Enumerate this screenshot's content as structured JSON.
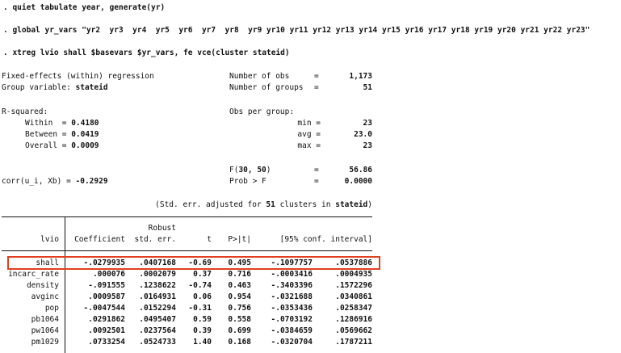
{
  "commands": [
    ". quiet tabulate year, generate(yr)",
    ". global yr_vars \"yr2  yr3  yr4  yr5  yr6  yr7  yr8  yr9 yr10 yr11 yr12 yr13 yr14 yr15 yr16 yr17 yr18 yr19 yr20 yr21 yr22 yr23\"",
    ". xtreg lvio shall $basevars $yr_vars, fe vce(cluster stateid)"
  ],
  "header": {
    "model": "Fixed-effects (within) regression",
    "group_label": "Group variable: ",
    "group_value": "stateid",
    "nobs_label": "Number of obs",
    "nobs_eq": "=",
    "nobs_value": "1,173",
    "ngroups_label": "Number of groups",
    "ngroups_eq": "=",
    "ngroups_value": "51",
    "rsq_label": "R-squared:",
    "within_label": "Within  = ",
    "within_value": "0.4180",
    "between_label": "Between = ",
    "between_value": "0.0419",
    "overall_label": "Overall = ",
    "overall_value": "0.0009",
    "obs_per_group_label": "Obs per group:",
    "min_label": "min =",
    "min_value": "23",
    "avg_label": "avg =",
    "avg_value": "23.0",
    "max_label": "max =",
    "max_value": "23",
    "f_label_pre": "F(",
    "f_df": "30, 50",
    "f_label_post": ")",
    "f_eq": "=",
    "f_value": "56.86",
    "corr_label": "corr(u_i, Xb) = ",
    "corr_value": "-0.2929",
    "probf_label": "Prob > F",
    "probf_eq": "=",
    "probf_value": "0.0000",
    "note_pre": "(Std. err. adjusted for ",
    "note_n": "51",
    "note_mid": " clusters in ",
    "note_var": "stateid",
    "note_post": ")"
  },
  "table": {
    "depvar": "lvio",
    "robust_label": "Robust",
    "columns": [
      "Coefficient",
      "std. err.",
      "t",
      "P>|t|",
      "[95% conf. interval]"
    ],
    "rows": [
      {
        "var": "shall",
        "coef": "-.0279935",
        "se": ".0407168",
        "t": "-0.69",
        "p": "0.495",
        "lo": "-.1097757",
        "hi": ".0537886"
      },
      {
        "var": "incarc_rate",
        "coef": ".000076",
        "se": ".0002079",
        "t": "0.37",
        "p": "0.716",
        "lo": "-.0003416",
        "hi": ".0004935"
      },
      {
        "var": "density",
        "coef": "-.091555",
        "se": ".1238622",
        "t": "-0.74",
        "p": "0.463",
        "lo": "-.3403396",
        "hi": ".1572296"
      },
      {
        "var": "avginc",
        "coef": ".0009587",
        "se": ".0164931",
        "t": "0.06",
        "p": "0.954",
        "lo": "-.0321688",
        "hi": ".0340861"
      },
      {
        "var": "pop",
        "coef": "-.0047544",
        "se": ".0152294",
        "t": "-0.31",
        "p": "0.756",
        "lo": "-.0353436",
        "hi": ".0258347"
      },
      {
        "var": "pb1064",
        "coef": ".0291862",
        "se": ".0495407",
        "t": "0.59",
        "p": "0.558",
        "lo": "-.0703192",
        "hi": ".1286916"
      },
      {
        "var": "pw1064",
        "coef": ".0092501",
        "se": ".0237564",
        "t": "0.39",
        "p": "0.699",
        "lo": "-.0384659",
        "hi": ".0569662"
      },
      {
        "var": "pm1029",
        "coef": ".0733254",
        "se": ".0524733",
        "t": "1.40",
        "p": "0.168",
        "lo": "-.0320704",
        "hi": ".1787211"
      }
    ]
  },
  "highlight": {
    "row": "shall",
    "color": "#e0401e"
  }
}
